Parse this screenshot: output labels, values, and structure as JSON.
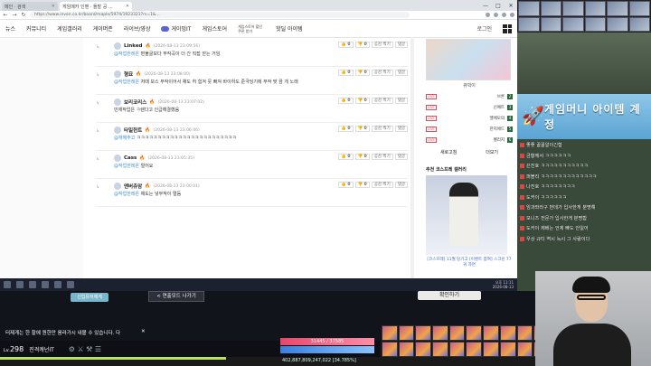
{
  "browser": {
    "tabs": [
      {
        "title": "메인 · 검색",
        "active": false
      },
      {
        "title": "게임메카 인벤 · 돌발 공 ...",
        "active": true
      }
    ],
    "url": "https://www.inven.co.kr/board/maple/5974/1923321?rs=1&...",
    "window_controls": [
      "—",
      "□",
      "✕"
    ]
  },
  "site_nav": {
    "items": [
      "뉴스",
      "커뮤니티",
      "게임갤러리",
      "게이머존",
      "라이브/영상",
      "게이밍IT",
      "게임스토어"
    ],
    "promo_text": "게임스토어 할인 쿠폰 받기",
    "hot_item": "핫딜 아이템",
    "login_label": "로그인"
  },
  "comments": [
    {
      "name": "Linked",
      "date": "(2026-08-13 23:09:56)",
      "body_mention": "",
      "body": "편불굴보다 무작곡이 더 간 직접 얻는 거임",
      "mention": "@작업한레온"
    },
    {
      "name": "형묘",
      "date": "(2026-08-13 23:08:00)",
      "body": "저때 보스 무작이어서 채도 허 힘겨 뭇 빠져 바이하도 준극딩기에 무작 맞 끔 개 노래",
      "mention": "@작업한레온"
    },
    {
      "name": "보리코리스",
      "date": "(2026-08-13 23:07:02)",
      "body": "민재작업은 ㅋ렌다고 인급해결했음",
      "mention": ""
    },
    {
      "name": "타일헌트",
      "date": "(2026-08-13 23:06:46)",
      "body": "ㅋㅋㅋㅋㅋㅋㅋㅋㅋㅋㅋㅋㅋㅋㅋㅋㅋㅋㅋㅋㅋㅋㅋㅋ",
      "mention": "@재해주고"
    },
    {
      "name": "Cass",
      "date": "(2026-08-13 23:05:35)",
      "body": "얼어요",
      "mention": "@작업한레온"
    },
    {
      "name": "앤버츄암",
      "date": "(2026-08-13 23:00:01)",
      "body": "채도는 넣무작이 멀듬",
      "mention": "@작업한레온"
    }
  ],
  "comment_actions": {
    "like": "0",
    "dislike": "0",
    "share": "공감 찍기",
    "reply": "댓글"
  },
  "right_panel": {
    "thumb_caption": "큐빅이",
    "live_list": [
      {
        "tag": "LIVE",
        "name": "브론",
        "rank": "2"
      },
      {
        "tag": "LIVE",
        "name": "신예트",
        "rank": "3"
      },
      {
        "tag": "LIVE",
        "name": "엘에모의",
        "rank": "4"
      },
      {
        "tag": "LIVE",
        "name": "한지에드",
        "rank": "5"
      },
      {
        "tag": "LIVE",
        "name": "벨리지",
        "rank": "6"
      }
    ],
    "tabs": [
      "새로고침",
      "더보기"
    ],
    "gallery_title": "추천 코스프레 갤러리",
    "gallery_caption": "[코스프레] 11월 당기고 [이벤트 참여] 스크린 77 귀 자면"
  },
  "stream_sidebar": {
    "banner": "게임머니 아이템 계정",
    "chat": [
      "좋좋 꿀꿀알이긴함",
      "금황께서 ㅋㅋㅋㅋㅋㅋ",
      "끈진호 ㅋㅋㅋㅋㅋㅋㅋㅋㅋㅋㅋ",
      "퍼블리 ㅋㅋㅋㅋㅋㅋㅋㅋㅋㅋㅋㅋㅋ",
      "나진호 ㅋㅋㅋㅋㅋㅋㅋㅋ",
      "도커이 ㅋㅋㅋㅋㅋㅋ",
      "임과좌라구 번데가 입사한게 분명해",
      "모니즈 전문가 입사한게 분명함",
      "도커이 제베는 언제 빠도 안일어",
      "우상 규티 역시 녹시 그 사람이다"
    ]
  },
  "taskbar": {
    "clock_time": "오후 11:11",
    "clock_date": "2026-08-13"
  },
  "game": {
    "char_label": "신입유저에게",
    "tutorial_button": "< 연출모드 나가기",
    "confirm_button": "확인하기",
    "notice": "터제게는 한 할에 원한만 움라가시 내볼 수 있습니다. 다",
    "level_label": "Lv.",
    "level": "298",
    "char_name": "진격캐넌IT",
    "hp": "31445 / 37585",
    "mp": "",
    "exp_text": "402,887,809,247,022 [34.785%]",
    "exp_percent": 34.785
  }
}
